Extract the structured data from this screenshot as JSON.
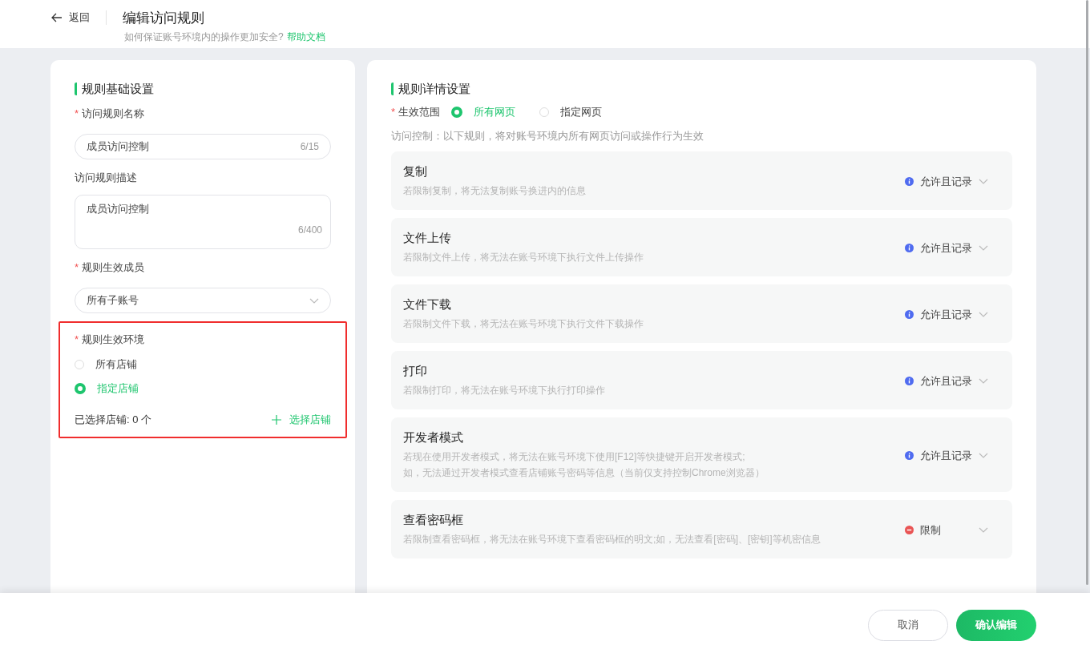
{
  "header": {
    "back": "返回",
    "title": "编辑访问规则",
    "subtitle": "如何保证账号环境内的操作更加安全?",
    "help_link": "帮助文档"
  },
  "basic": {
    "title": "规则基础设置",
    "name_field": {
      "label": "访问规则名称",
      "required_mark": "*",
      "value": "成员访问控制",
      "count": "6/15"
    },
    "desc_field": {
      "label": "访问规则描述",
      "value": "成员访问控制",
      "count": "6/400"
    },
    "members_field": {
      "label": "规则生效成员",
      "required_mark": "*",
      "value": "所有子账号"
    },
    "env": {
      "label": "规则生效环境",
      "required_mark": "*",
      "highlighted": true,
      "options": [
        {
          "label": "所有店铺",
          "selected": false
        },
        {
          "label": "指定店铺",
          "selected": true
        }
      ],
      "selected_count": "已选择店铺: 0 个",
      "select_button": "选择店铺"
    }
  },
  "detail": {
    "title": "规则详情设置",
    "scope": {
      "label": "生效范围",
      "required_mark": "*",
      "options": [
        {
          "label": "所有网页",
          "selected": true
        },
        {
          "label": "指定网页",
          "selected": false
        }
      ]
    },
    "note": "访问控制：以下规则，将对账号环境内所有网页访问或操作行为生效",
    "rules": [
      {
        "name": "复制",
        "description": [
          "若限制复制，将无法复制账号换进内的信息"
        ],
        "kind": "allow",
        "status_label": "允许且记录"
      },
      {
        "name": "文件上传",
        "description": [
          "若限制文件上传，将无法在账号环境下执行文件上传操作"
        ],
        "kind": "allow",
        "status_label": "允许且记录"
      },
      {
        "name": "文件下载",
        "description": [
          "若限制文件下载，将无法在账号环境下执行文件下载操作"
        ],
        "kind": "allow",
        "status_label": "允许且记录"
      },
      {
        "name": "打印",
        "description": [
          "若限制打印，将无法在账号环境下执行打印操作"
        ],
        "kind": "allow",
        "status_label": "允许且记录"
      },
      {
        "name": "开发者模式",
        "description": [
          "若现在使用开发者模式，将无法在账号环境下使用[F12]等快捷键开启开发者模式;",
          "如，无法通过开发者模式查看店铺账号密码等信息（当前仅支持控制Chrome浏览器）"
        ],
        "kind": "allow",
        "status_label": "允许且记录"
      },
      {
        "name": "查看密码框",
        "description": [
          "若限制查看密码框，将无法在账号环境下查看密码框的明文;如，无法查看[密码]、[密钥]等机密信息"
        ],
        "kind": "restrict",
        "status_label": "限制"
      }
    ]
  },
  "footer": {
    "cancel": "取消",
    "confirm": "确认编辑"
  }
}
